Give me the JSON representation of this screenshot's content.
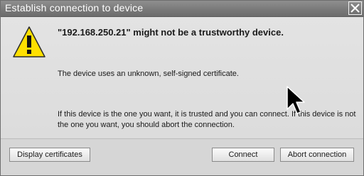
{
  "window": {
    "title": "Establish connection to device"
  },
  "icons": {
    "close": "close-icon",
    "warning": "warning-icon",
    "cursor": "mouse-pointer-icon"
  },
  "message": {
    "headline": "\"192.168.250.21\" might not be a trustworthy device.",
    "detail": "The device uses an unknown, self-signed certificate.",
    "guidance": "If this device is the one you want, it is trusted and you can connect. If this device is not the one you want, you should abort the connection."
  },
  "buttons": {
    "display_certificates": "Display certificates",
    "connect": "Connect",
    "abort": "Abort connection"
  },
  "colors": {
    "warning_fill": "#ffe000",
    "warning_stroke": "#2b2b2b",
    "titlebar": "#7a7a7a"
  }
}
